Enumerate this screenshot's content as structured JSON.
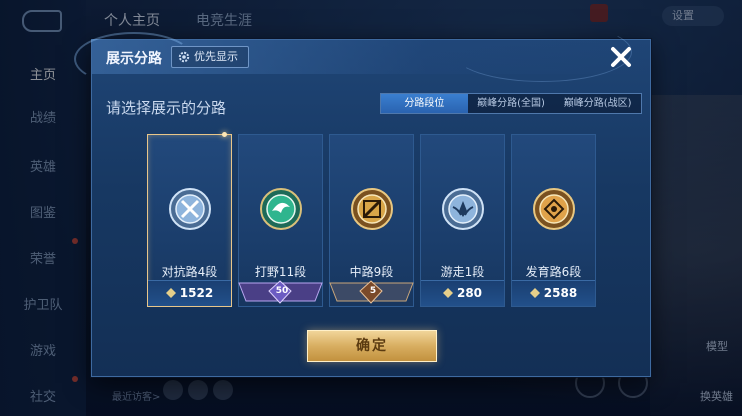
{
  "background": {
    "top_tabs": [
      "个人主页",
      "电竞生涯"
    ],
    "settings_label": "设置",
    "nav_items": [
      "主页",
      "战绩",
      "英雄",
      "图鉴",
      "荣誉",
      "护卫队",
      "游戏",
      "社交"
    ],
    "bottom_text": "最近访客>",
    "right_labels": [
      "模型",
      "换英雄"
    ]
  },
  "modal": {
    "title": "展示分路",
    "priority_label": "优先显示",
    "subtitle": "请选择展示的分路",
    "tabs": [
      {
        "label": "分路段位",
        "active": true
      },
      {
        "label": "巅峰分路(全国)",
        "active": false
      },
      {
        "label": "巅峰分路(战区)",
        "active": false
      }
    ],
    "cards": [
      {
        "name": "对抗路4段",
        "points": "1522",
        "emblem": "shield-crossed-swords-icon",
        "emblem_color": "#9fc2e6",
        "footer": "points",
        "selected": true
      },
      {
        "name": "打野11段",
        "points": "50",
        "emblem": "jungle-dragon-icon",
        "emblem_color": "#2fb58e",
        "footer": "ribbon-purple"
      },
      {
        "name": "中路9段",
        "points": "5",
        "emblem": "mid-lane-slash-icon",
        "emblem_color": "#d8a548",
        "footer": "ribbon-bronze"
      },
      {
        "name": "游走1段",
        "points": "280",
        "emblem": "support-wings-icon",
        "emblem_color": "#9fc2e6",
        "footer": "points"
      },
      {
        "name": "发育路6段",
        "points": "2588",
        "emblem": "marksman-target-icon",
        "emblem_color": "#e0a24a",
        "footer": "points"
      }
    ],
    "confirm_label": "确定"
  },
  "colors": {
    "accent_gold": "#d8ae61",
    "tab_active": "#3a7fd0",
    "modal_bg": "#1b3e6c"
  }
}
